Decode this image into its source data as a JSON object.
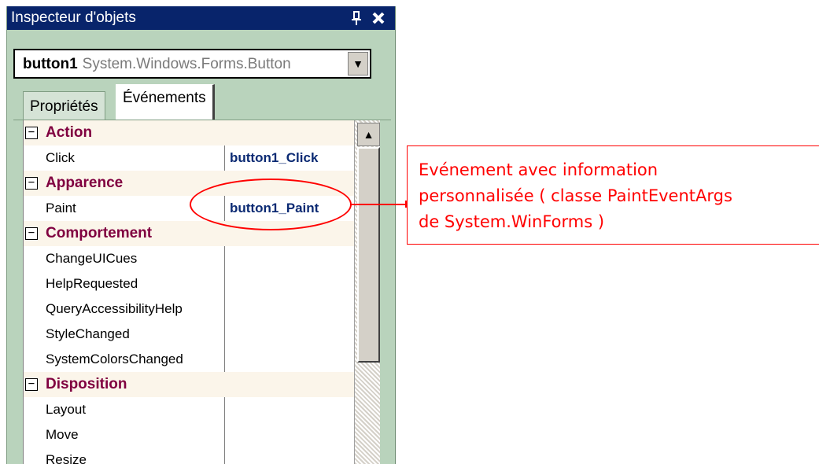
{
  "window": {
    "title": "Inspecteur d'objets",
    "pin_glyph": "📌",
    "close_glyph": "✕",
    "colors": {
      "titlebar": "#08246b",
      "panel": "#b9d3bc",
      "category": "#800040",
      "value": "#0b2a73",
      "annotation": "#ff0000"
    }
  },
  "selector": {
    "name": "button1",
    "type": "System.Windows.Forms.Button",
    "dropdown_icon": "▼"
  },
  "tabs": [
    {
      "label": "Propriétés",
      "active": false
    },
    {
      "label": "Événements",
      "active": true
    }
  ],
  "grid": {
    "toggle_glyph": "−",
    "rows": [
      {
        "kind": "category",
        "label": "Action"
      },
      {
        "kind": "property",
        "name": "Click",
        "value": "button1_Click"
      },
      {
        "kind": "category",
        "label": "Apparence"
      },
      {
        "kind": "property",
        "name": "Paint",
        "value": "button1_Paint"
      },
      {
        "kind": "category",
        "label": "Comportement"
      },
      {
        "kind": "property",
        "name": "ChangeUICues",
        "value": ""
      },
      {
        "kind": "property",
        "name": "HelpRequested",
        "value": ""
      },
      {
        "kind": "property",
        "name": "QueryAccessibilityHelp",
        "value": ""
      },
      {
        "kind": "property",
        "name": "StyleChanged",
        "value": ""
      },
      {
        "kind": "property",
        "name": "SystemColorsChanged",
        "value": ""
      },
      {
        "kind": "category",
        "label": "Disposition"
      },
      {
        "kind": "property",
        "name": "Layout",
        "value": ""
      },
      {
        "kind": "property",
        "name": "Move",
        "value": ""
      },
      {
        "kind": "property",
        "name": "Resize",
        "value": ""
      }
    ]
  },
  "scrollbar": {
    "up_icon": "▲"
  },
  "annotation": {
    "text": "Evénement avec information\npersonnalisée ( classe PaintEventArgs\nde System.WinForms )"
  }
}
